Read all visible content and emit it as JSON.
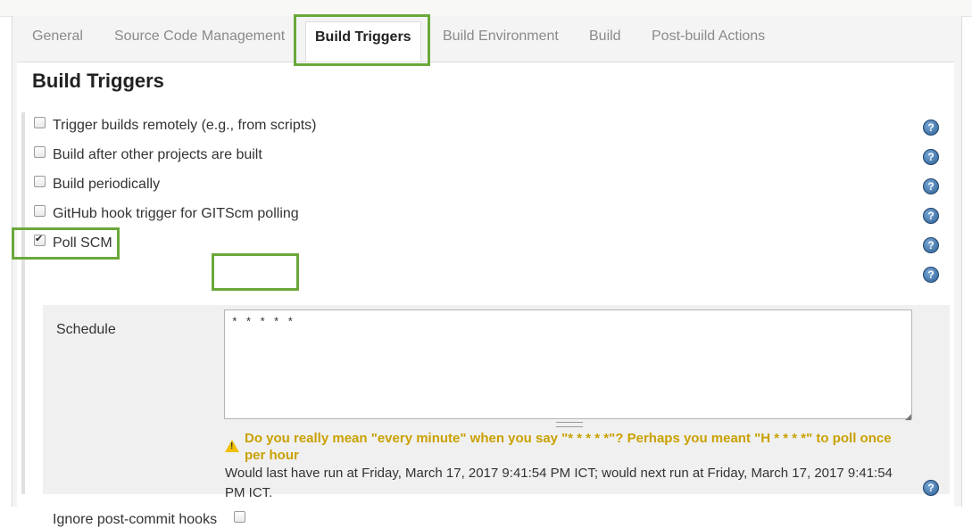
{
  "tabs": [
    {
      "label": "General"
    },
    {
      "label": "Source Code Management"
    },
    {
      "label": "Build Triggers"
    },
    {
      "label": "Build Environment"
    },
    {
      "label": "Build"
    },
    {
      "label": "Post-build Actions"
    }
  ],
  "section_title": "Build Triggers",
  "triggers": [
    {
      "label": "Trigger builds remotely (e.g., from scripts)",
      "checked": false
    },
    {
      "label": "Build after other projects are built",
      "checked": false
    },
    {
      "label": "Build periodically",
      "checked": false
    },
    {
      "label": "GitHub hook trigger for GITScm polling",
      "checked": false
    },
    {
      "label": "Poll SCM",
      "checked": true
    }
  ],
  "schedule": {
    "label": "Schedule",
    "value": "* * * * *",
    "warning": "Do you really mean \"every minute\" when you say \"* * * * *\"? Perhaps you meant \"H * * * *\" to poll once per hour",
    "info": "Would last have run at Friday, March 17, 2017 9:41:54 PM ICT; would next run at Friday, March 17, 2017 9:41:54 PM ICT."
  },
  "ignore_hooks": {
    "label": "Ignore post-commit hooks",
    "checked": false
  },
  "help_icon_text": "?",
  "colors": {
    "highlight": "#6aa83a",
    "warning": "#c9a100",
    "help": "#2c5f93"
  }
}
